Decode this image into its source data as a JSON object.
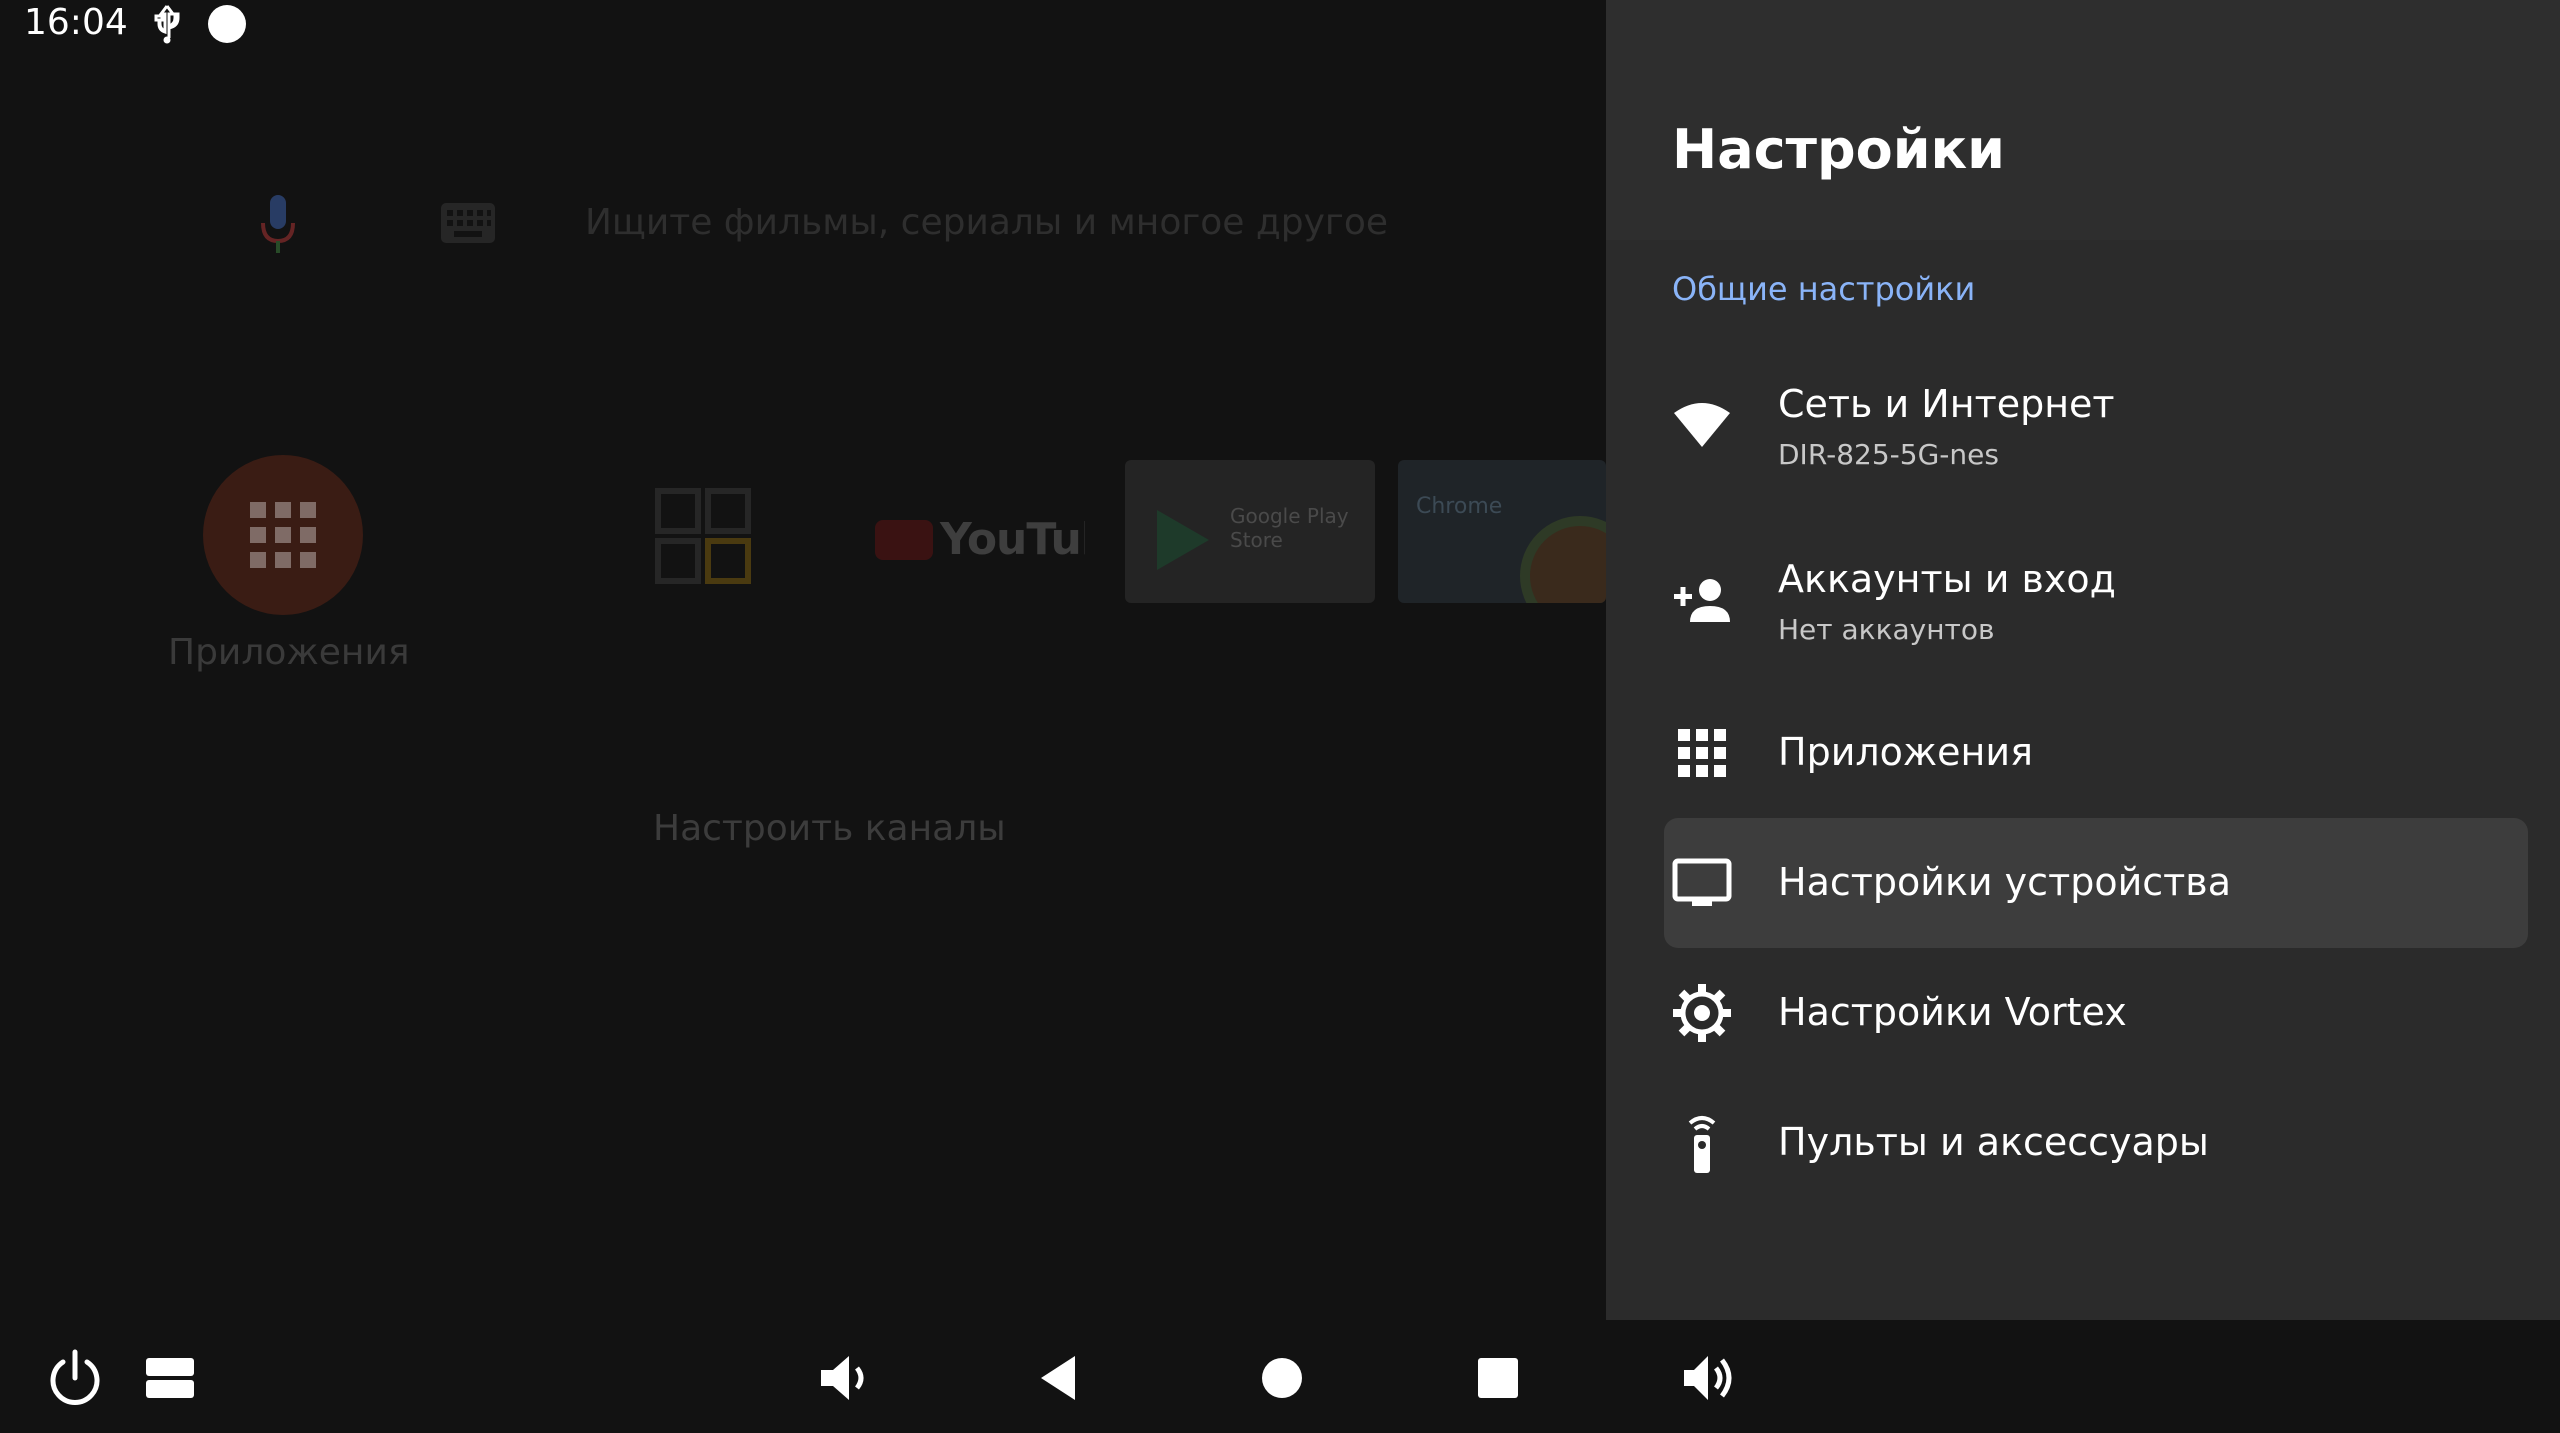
{
  "status_bar": {
    "time": "16:04",
    "icons": [
      "usb-icon",
      "notification-dot-icon",
      "wifi-icon"
    ]
  },
  "home": {
    "search_placeholder": "Ищите фильмы, сериалы и многое другое",
    "apps_label": "Приложения",
    "youtube_label": "YouTube",
    "play_label": "Google Play Store",
    "chrome_label": "Chrome",
    "setup_channels": "Настроить каналы"
  },
  "settings": {
    "title": "Настройки",
    "section": "Общие настройки",
    "items": [
      {
        "icon": "wifi-icon",
        "title": "Сеть и Интернет",
        "subtitle": "DIR-825-5G-nes"
      },
      {
        "icon": "add-account-icon",
        "title": "Аккаунты и вход",
        "subtitle": "Нет аккаунтов"
      },
      {
        "icon": "apps-grid-icon",
        "title": "Приложения"
      },
      {
        "icon": "tv-icon",
        "title": "Настройки устройства",
        "selected": true
      },
      {
        "icon": "gear-icon",
        "title": "Настройки Vortex"
      },
      {
        "icon": "remote-icon",
        "title": "Пульты и аксессуары"
      }
    ],
    "colors": {
      "panel_bg": "#2b2b2b",
      "selected_bg": "#3d3d3d",
      "accent": "#8ab4f8"
    }
  },
  "nav_bar": {
    "buttons": [
      "power-icon",
      "menu-icon",
      "volume-down-icon",
      "back-icon",
      "home-icon",
      "recents-icon",
      "volume-up-icon"
    ]
  }
}
